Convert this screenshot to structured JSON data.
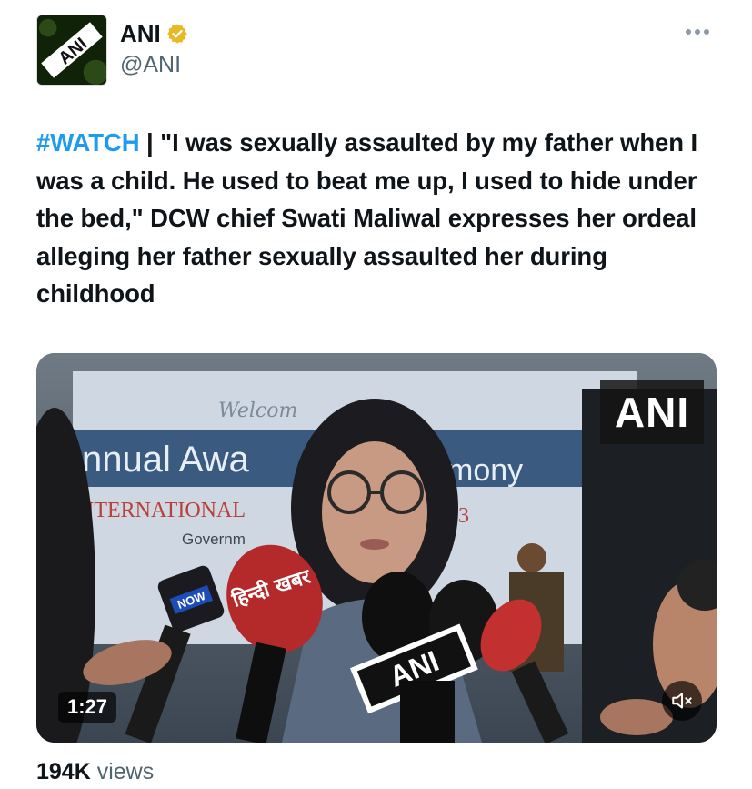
{
  "author": {
    "display_name": "ANI",
    "handle": "@ANI",
    "avatar_text": "ANI",
    "verified_color": "#e8b923"
  },
  "tweet": {
    "hashtag": "#WATCH",
    "text": " | \"I was sexually assaulted by my father when I was a child. He used to beat me up, I used to hide under the bed,\" DCW chief Swati Maliwal expresses her ordeal alleging her father sexually assaulted her during childhood"
  },
  "media": {
    "watermark": "ANI",
    "duration": "1:27",
    "banner_line1": "nnual Awa",
    "banner_line1b": "mony",
    "banner_line2": "NTERNATIONAL",
    "banner_line2b": "2023",
    "banner_line3": "Governm",
    "banner_script": "Welcom",
    "mic_left_label": "NOW",
    "mic_red_label": "हिन्दी खबर",
    "mic_center_label": "ANI"
  },
  "stats": {
    "views_count": "194K",
    "views_label": " views"
  },
  "colors": {
    "accent": "#1d9bf0",
    "text": "#0f1419",
    "muted": "#536471"
  }
}
